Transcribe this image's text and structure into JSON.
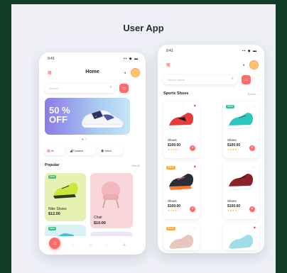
{
  "page": {
    "title": "User App"
  },
  "home": {
    "status_time": "9:41",
    "status_icons": "▪▪ ◆ ▬",
    "title": "Home",
    "search_placeholder": "Search",
    "banner": {
      "percent": "50 %",
      "label": "OFF"
    },
    "categories": [
      {
        "label": "All"
      },
      {
        "label": "Footwear"
      },
      {
        "label": "Watch"
      }
    ],
    "popular_title": "Popular",
    "see_all": "View All",
    "cards": [
      {
        "badge": "New",
        "name": "Nike Shoes",
        "price": "$12.00"
      },
      {
        "name": "Chair",
        "price": "$10.00"
      },
      {
        "badge": "New"
      }
    ]
  },
  "shop": {
    "status_time": "9:41",
    "status_icons": "▪▪ ◆ ▬",
    "search_placeholder": "Search Items",
    "section_title": "Sports Shoes",
    "sort_label": "Nearby ⌄",
    "products": [
      {
        "name": "Shoes",
        "price": "$100.00",
        "stars": "★★★★☆",
        "badge": ""
      },
      {
        "name": "Shoes",
        "price": "$100.00",
        "stars": "★★★★☆",
        "badge": "NEW"
      },
      {
        "name": "Shoes",
        "price": "$100.00",
        "stars": "★★★★☆",
        "badge": "SALE"
      },
      {
        "name": "Shoes",
        "price": "$100.00",
        "stars": "★★★★☆",
        "badge": ""
      },
      {
        "name": "",
        "price": "",
        "stars": "",
        "badge": "SALE"
      },
      {
        "name": "",
        "price": "",
        "stars": "",
        "badge": ""
      }
    ]
  },
  "colors": {
    "accent": "#ff6b6b",
    "background": "#eef0f6",
    "frame": "#0f3d26"
  }
}
